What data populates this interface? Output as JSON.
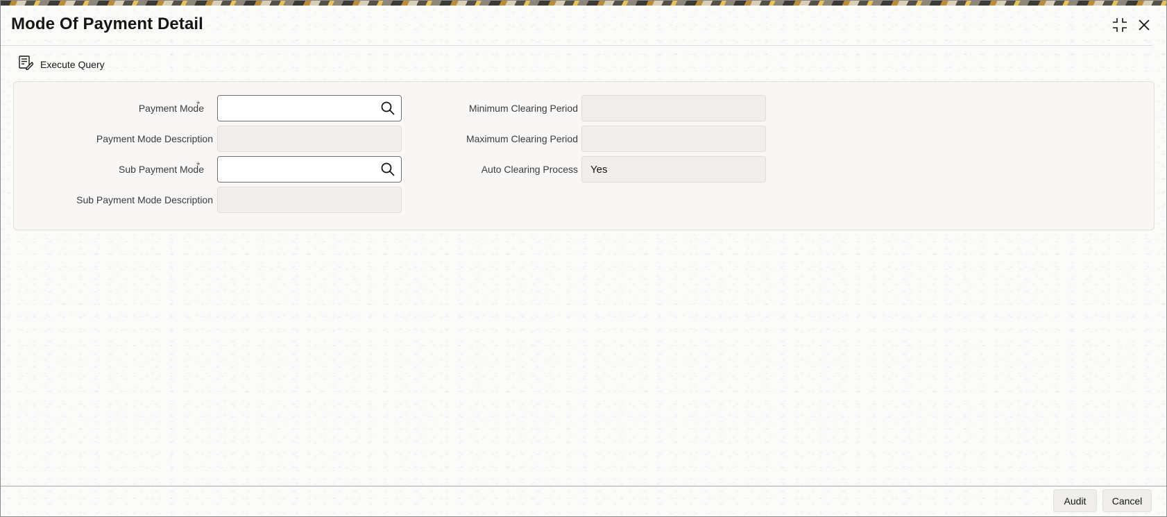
{
  "window": {
    "title": "Mode Of Payment Detail",
    "maximize_icon": "maximize-icon",
    "close_icon": "close-icon"
  },
  "toolbar": {
    "execute_query_label": "Execute Query",
    "execute_query_icon": "execute-query-icon"
  },
  "form": {
    "payment_mode": {
      "label": "Payment Mode",
      "required_mark": "*",
      "value": ""
    },
    "payment_mode_description": {
      "label": "Payment Mode Description",
      "value": ""
    },
    "sub_payment_mode": {
      "label": "Sub Payment Mode",
      "required_mark": "*",
      "value": ""
    },
    "sub_payment_mode_description": {
      "label": "Sub Payment Mode Description",
      "value": ""
    },
    "minimum_clearing_period": {
      "label": "Minimum Clearing Period",
      "value": ""
    },
    "maximum_clearing_period": {
      "label": "Maximum Clearing Period",
      "value": ""
    },
    "auto_clearing_process": {
      "label": "Auto Clearing Process",
      "value": "Yes"
    }
  },
  "footer": {
    "audit_label": "Audit",
    "cancel_label": "Cancel"
  },
  "colors": {
    "panel_background": "#f8f7f6",
    "readonly_field": "#f1efed",
    "button_background": "#efeeec"
  }
}
